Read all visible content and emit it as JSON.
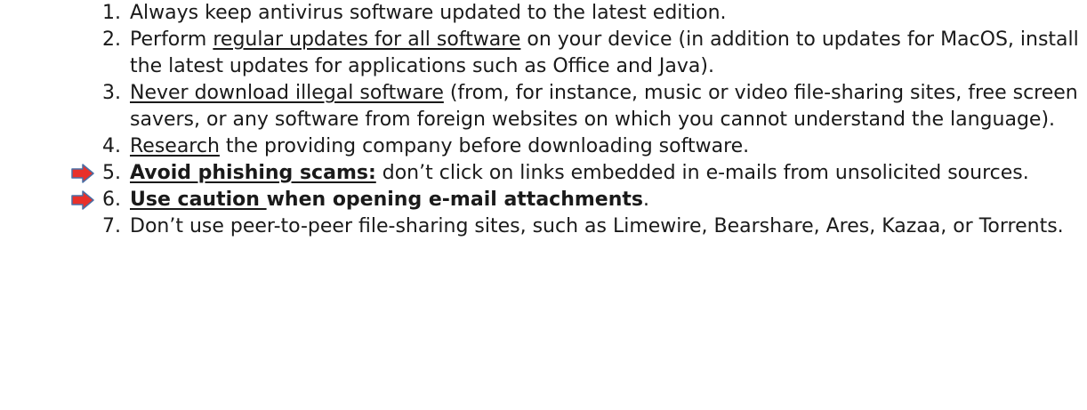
{
  "items": [
    {
      "number": "1.",
      "segments": [
        {
          "text": "Always keep antivirus software updated to the latest edition.",
          "style": "plain"
        }
      ]
    },
    {
      "number": "2.",
      "segments": [
        {
          "text": "Perform ",
          "style": "plain"
        },
        {
          "text": "regular updates for all software",
          "style": "underline"
        },
        {
          "text": " on your device (in addition to updates for MacOS, install the latest updates for applications such as Office and Java).",
          "style": "plain"
        }
      ]
    },
    {
      "number": "3.",
      "segments": [
        {
          "text": "Never download illegal software",
          "style": "underline"
        },
        {
          "text": " (from, for instance, music or video file-sharing sites, free screen savers, or any software from foreign websites on which you cannot understand the language).",
          "style": "plain"
        }
      ]
    },
    {
      "number": "4.",
      "segments": [
        {
          "text": "Research",
          "style": "underline"
        },
        {
          "text": " the providing company before downloading software.",
          "style": "plain"
        }
      ]
    },
    {
      "number": "5.",
      "segments": [
        {
          "text": "Avoid phishing scams:",
          "style": "bold-underline"
        },
        {
          "text": " don’t click on links embedded in e-mails from unsolicited sources.",
          "style": "plain"
        }
      ]
    },
    {
      "number": "6.",
      "segments": [
        {
          "text": "Use caution ",
          "style": "bold-underline"
        },
        {
          "text": "when opening e-mail attachments",
          "style": "bold"
        },
        {
          "text": ".",
          "style": "plain"
        }
      ]
    },
    {
      "number": "7.",
      "segments": [
        {
          "text": "Don’t use peer-to-peer file-sharing sites, such as Limewire, Bearshare, Ares, Kazaa, or Torrents.",
          "style": "plain"
        }
      ]
    }
  ],
  "highlight_arrow": {
    "icon": "right-arrow-icon",
    "fill": "#e8302a",
    "stroke": "#4a6fa5"
  }
}
